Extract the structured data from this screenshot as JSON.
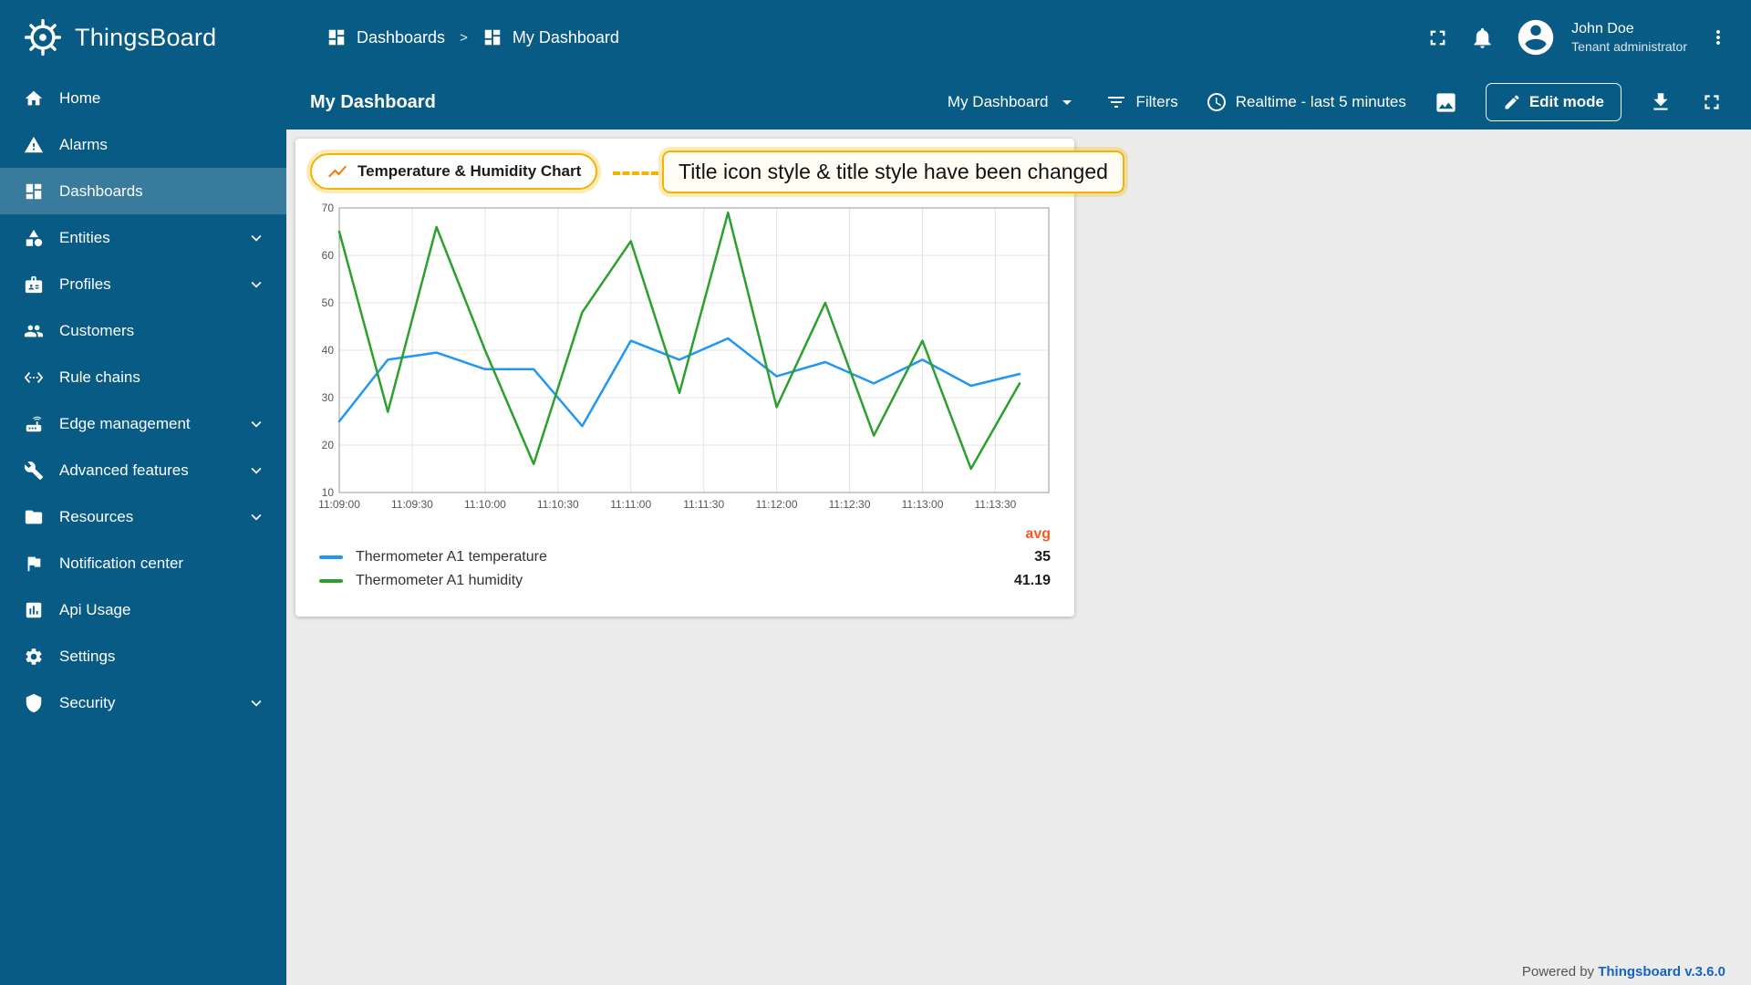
{
  "app": {
    "name": "ThingsBoard",
    "footer": {
      "powered_by": "Powered by ",
      "version": "Thingsboard v.3.6.0"
    }
  },
  "header": {
    "breadcrumb": [
      {
        "label": "Dashboards",
        "icon": "dashboards-grid"
      },
      {
        "label": "My Dashboard",
        "icon": "dashboards-grid"
      }
    ],
    "separator": ">",
    "actions": [
      {
        "icon": "fullscreen"
      },
      {
        "icon": "notifications-bell"
      }
    ],
    "user": {
      "name": "John Doe",
      "role": "Tenant administrator",
      "icon": "account-circle"
    },
    "more_menu_icon": "kebab-vertical"
  },
  "sidebar": {
    "items": [
      {
        "label": "Home",
        "icon": "home",
        "expandable": false,
        "selected": false
      },
      {
        "label": "Alarms",
        "icon": "warning-triangle",
        "expandable": false,
        "selected": false
      },
      {
        "label": "Dashboards",
        "icon": "dashboards-grid",
        "expandable": false,
        "selected": true
      },
      {
        "label": "Entities",
        "icon": "category",
        "expandable": true,
        "selected": false
      },
      {
        "label": "Profiles",
        "icon": "badge",
        "expandable": true,
        "selected": false
      },
      {
        "label": "Customers",
        "icon": "people-group",
        "expandable": false,
        "selected": false
      },
      {
        "label": "Rule chains",
        "icon": "code-brackets",
        "expandable": false,
        "selected": false
      },
      {
        "label": "Edge management",
        "icon": "router-antenna",
        "expandable": true,
        "selected": false
      },
      {
        "label": "Advanced features",
        "icon": "wrench",
        "expandable": true,
        "selected": false
      },
      {
        "label": "Resources",
        "icon": "folder",
        "expandable": true,
        "selected": false
      },
      {
        "label": "Notification center",
        "icon": "flag",
        "expandable": false,
        "selected": false
      },
      {
        "label": "Api Usage",
        "icon": "chart-box",
        "expandable": false,
        "selected": false
      },
      {
        "label": "Settings",
        "icon": "gear",
        "expandable": false,
        "selected": false
      },
      {
        "label": "Security",
        "icon": "shield",
        "expandable": true,
        "selected": false
      }
    ]
  },
  "toolbar": {
    "title": "My Dashboard",
    "dashboard_select": "My Dashboard",
    "dashboard_select_icon": "dropdown-arrow",
    "filters_label": "Filters",
    "filters_icon": "filter",
    "timewindow_label": "Realtime - last 5 minutes",
    "timewindow_icon": "clock",
    "image_button_icon": "image",
    "edit_mode_label": "Edit mode",
    "edit_mode_icon": "pencil",
    "download_icon": "download",
    "fullscreen_icon": "fullscreen"
  },
  "widget": {
    "title": "Temperature & Humidity Chart",
    "title_icon": "line-chart"
  },
  "annotation": {
    "text": "Title icon style & title style have been changed"
  },
  "legend": {
    "avg_header": "avg",
    "items": [
      {
        "label": "Thermometer A1 temperature",
        "avg": "35",
        "color": "#2196f3"
      },
      {
        "label": "Thermometer A1 humidity",
        "avg": "41.19",
        "color": "#2ca02c"
      }
    ]
  },
  "chart_data": {
    "type": "line",
    "title": "Temperature & Humidity Chart",
    "timewindow": "Realtime - last 5 minutes",
    "x": [
      "11:09:00",
      "11:09:20",
      "11:09:40",
      "11:10:00",
      "11:10:20",
      "11:10:40",
      "11:11:00",
      "11:11:20",
      "11:11:40",
      "11:12:00",
      "11:12:20",
      "11:12:40",
      "11:13:00",
      "11:13:20",
      "11:13:40"
    ],
    "series": [
      {
        "name": "Thermometer A1 temperature",
        "color": "#2196f3",
        "avg": 35,
        "values": [
          25,
          38,
          39.5,
          36,
          36,
          24,
          42,
          38,
          42.5,
          34.5,
          37.5,
          33,
          38,
          32.5,
          35
        ]
      },
      {
        "name": "Thermometer A1 humidity",
        "color": "#2ca02c",
        "avg": 41.19,
        "values": [
          65,
          27,
          66,
          40,
          16,
          48,
          63,
          31,
          69,
          28,
          50,
          22,
          42,
          15,
          33
        ]
      }
    ],
    "x_ticks": [
      "11:09:00",
      "11:09:30",
      "11:10:00",
      "11:10:30",
      "11:11:00",
      "11:11:30",
      "11:12:00",
      "11:12:30",
      "11:13:00",
      "11:13:30"
    ],
    "x_span_seconds": 292,
    "ylim": [
      10,
      70
    ],
    "y_ticks": [
      10,
      20,
      30,
      40,
      50,
      60,
      70
    ],
    "grid": true,
    "legend_position": "bottom"
  }
}
